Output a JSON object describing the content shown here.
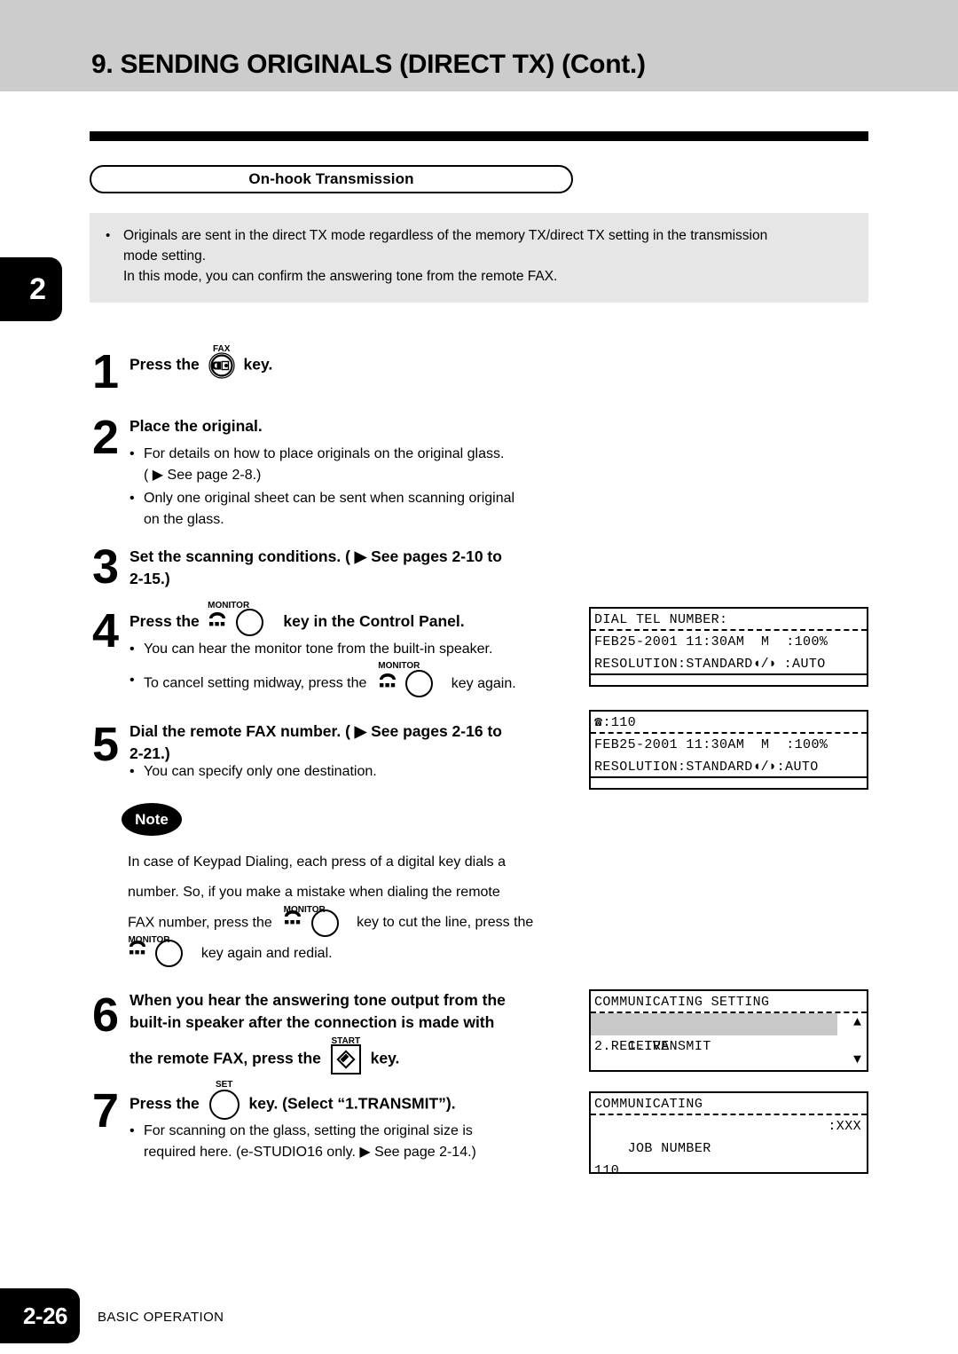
{
  "header": {
    "title": "9. SENDING ORIGINALS (DIRECT TX) (Cont.)",
    "chapter_tab": "2"
  },
  "section": {
    "title": "On-hook Transmission",
    "intro_bullet_line1": "Originals are sent in the direct TX mode regardless of the memory TX/direct TX setting in the transmission",
    "intro_bullet_line2": "mode setting.",
    "intro_bullet_line3": "In this mode, you can confirm the answering tone from the remote FAX.",
    "bullet_char": "•"
  },
  "steps": [
    {
      "number": "1",
      "text_before": "Press the",
      "key_label": "FAX",
      "key_name": "fax-key",
      "text_after": "key."
    },
    {
      "number": "2",
      "heading": "Place the original.",
      "bullets": [
        "For details on how to place originals on the original glass.",
        "( ▶ See page 2-8.)",
        "Only one original sheet can be sent when scanning original",
        "on the glass."
      ]
    },
    {
      "number": "3",
      "heading_line1": "Set the scanning conditions. ( ▶ See pages 2-10 to",
      "heading_line2": "2-15.)"
    },
    {
      "number": "4",
      "text_before": "Press the",
      "key_label": "MONITOR",
      "text_after": "key in the Control Panel.",
      "bullet1": "You can hear the monitor tone from the built-in speaker.",
      "bullet2_before": "To cancel setting midway, press the",
      "bullet2_key": "MONITOR",
      "bullet2_after": "key again."
    },
    {
      "number": "5",
      "heading_line1": "Dial the remote FAX number. ( ▶ See pages 2-16 to",
      "heading_line2": "2-21.)",
      "bullet1": "You can specify only one destination."
    },
    {
      "number": "6",
      "line1": "When you hear the answering tone output from the",
      "line2": "built-in speaker after the connection is made with",
      "line3_before": "the remote FAX, press the",
      "key_label": "START",
      "line3_after": "key."
    },
    {
      "number": "7",
      "text_before": "Press the",
      "key_label": "SET",
      "text_after": "key. (Select “1.TRANSMIT”).",
      "bullet_line1": "For scanning on the glass, setting the original size is",
      "bullet_line2": "required here. (e-STUDIO16 only. ▶ See page 2-14.)"
    }
  ],
  "note": {
    "badge": "Note",
    "line1": "In case of Keypad Dialing, each press of a digital key dials a",
    "line2": "number.  So, if you make a mistake when dialing the remote",
    "line3_before": "FAX number, press the",
    "line3_key": "MONITOR",
    "line3_after": "key to cut the line, press the",
    "line4_key": "MONITOR",
    "line4_after": "key again and redial."
  },
  "lcd_panels": [
    {
      "id": "lcd-dial-tel-number",
      "row1": "DIAL TEL NUMBER:",
      "row2": "FEB25-2001 11:30AM  M  :100%",
      "row3_left": "RESOLUTION:STANDARD",
      "row3_contrast": "◖/◗",
      "row3_right": ":AUTO",
      "row4": ""
    },
    {
      "id": "lcd-dialed-number",
      "row1_icon": "☎",
      "row1": ":110",
      "row2": "FEB25-2001 11:30AM  M  :100%",
      "row3_left": "RESOLUTION:STANDARD",
      "row3_contrast": "◖/◗",
      "row3_right": ":AUTO",
      "row4": ""
    },
    {
      "id": "lcd-communicating-setting",
      "row1": "COMMUNICATING SETTING",
      "row2": "1.TRANSMIT",
      "row3": "2.RECEIVE",
      "row4": "",
      "scroll_up": "▲",
      "scroll_down": "▼"
    },
    {
      "id": "lcd-communicating",
      "row1": "COMMUNICATING",
      "row2_left": "JOB NUMBER",
      "row2_right": ":XXX",
      "row3": "",
      "row4": "110"
    }
  ],
  "footer": {
    "page_number": "2-26",
    "label": "BASIC OPERATION"
  }
}
